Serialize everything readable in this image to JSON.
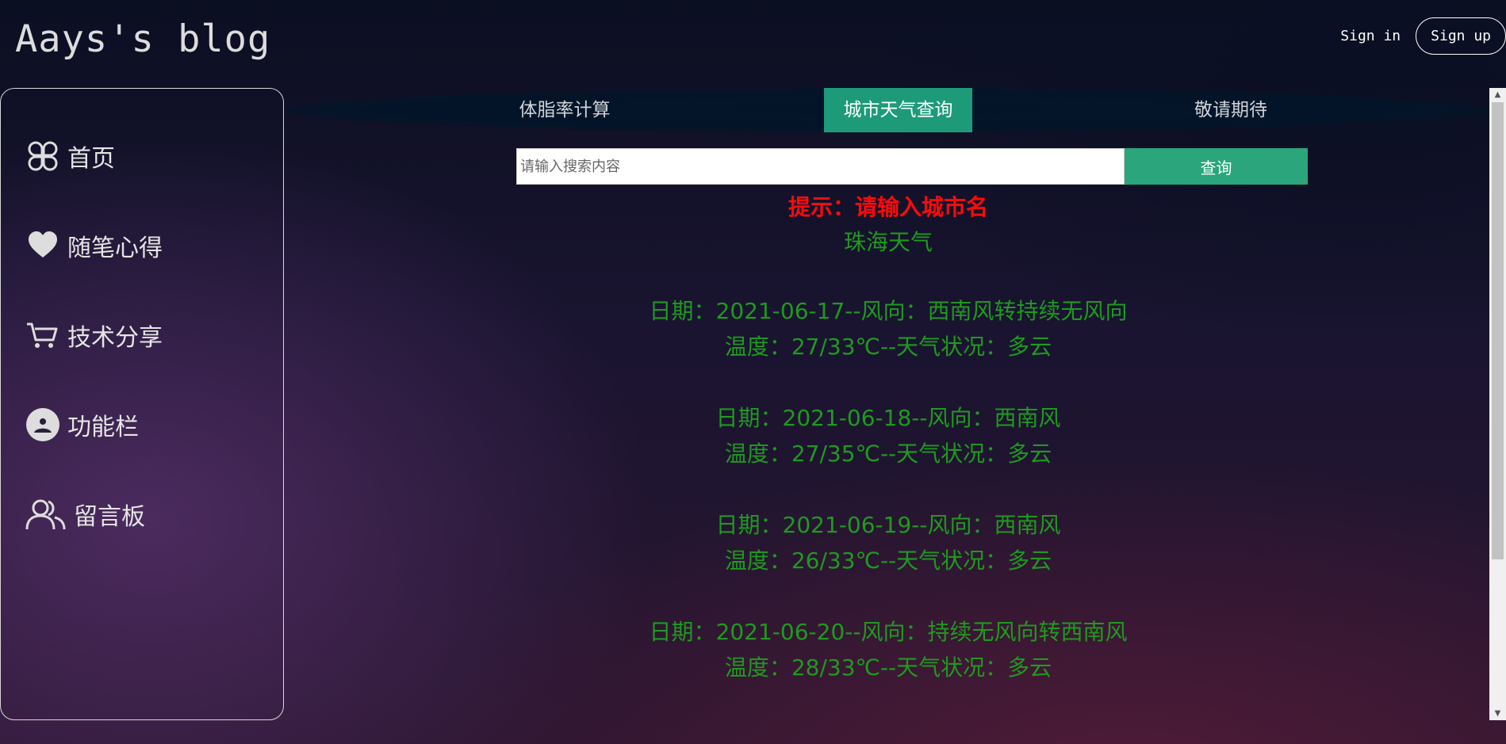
{
  "header": {
    "title": "Aays's blog",
    "sign_in": "Sign in",
    "sign_up": "Sign up"
  },
  "sidebar": {
    "items": [
      {
        "label": "首页",
        "icon": "apps-grid-icon"
      },
      {
        "label": "随笔心得",
        "icon": "heart-icon"
      },
      {
        "label": "技术分享",
        "icon": "cart-icon"
      },
      {
        "label": "功能栏",
        "icon": "user-circle-icon"
      },
      {
        "label": "留言板",
        "icon": "users-icon"
      }
    ]
  },
  "tabs": [
    {
      "label": "体脂率计算",
      "active": false
    },
    {
      "label": "城市天气查询",
      "active": true
    },
    {
      "label": "敬请期待",
      "active": false
    }
  ],
  "search": {
    "placeholder": "请输入搜索内容",
    "value": "",
    "button_label": "查询"
  },
  "weather": {
    "hint": "提示：请输入城市名",
    "city_title": "珠海天气",
    "days": [
      {
        "line1": "日期：2021-06-17--风向：西南风转持续无风向",
        "line2": "温度：27/33℃--天气状况：多云"
      },
      {
        "line1": "日期：2021-06-18--风向：西南风",
        "line2": "温度：27/35℃--天气状况：多云"
      },
      {
        "line1": "日期：2021-06-19--风向：西南风",
        "line2": "温度：26/33℃--天气状况：多云"
      },
      {
        "line1": "日期：2021-06-20--风向：持续无风向转西南风",
        "line2": "温度：28/33℃--天气状况：多云"
      }
    ]
  },
  "colors": {
    "accent": "#1d9b78",
    "button": "#2aa57c",
    "hint": "#ff0a0a",
    "weather_text": "#1e9a1e"
  }
}
